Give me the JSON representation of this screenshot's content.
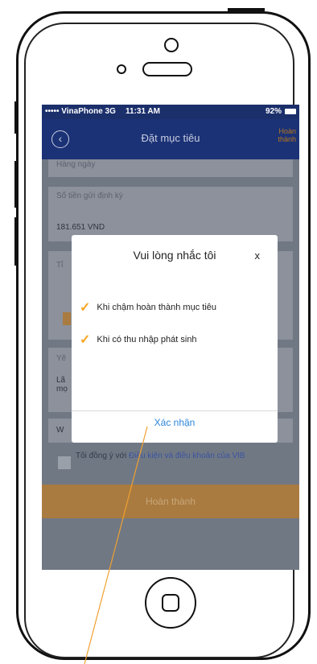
{
  "status_bar": {
    "carrier": "••••• VinaPhone  3G",
    "time": "11:31 AM",
    "battery": "92%"
  },
  "nav": {
    "back_icon": "chevron-left",
    "title": "Đặt mục tiêu",
    "done_line1": "Hoàn",
    "done_line2": "thành"
  },
  "form": {
    "frequency_value": "Hàng ngày",
    "deposit_label": "Số tiền gửi định kỳ",
    "deposit_value": "181.651 VND",
    "field_partial_1": "Tỉ",
    "field_partial_2": "Yê",
    "field_partial_3_line1": "Lã",
    "field_partial_3_line2": "mọ",
    "field_partial_4": "W",
    "agree_text": "Tôi đồng ý với ",
    "agree_link": "Điều kiện và điều khoản của VIB",
    "complete_button": "Hoàn thành"
  },
  "modal": {
    "title": "Vui lòng nhắc tôi",
    "close": "x",
    "options": [
      {
        "label": "Khi chậm hoàn thành mục tiêu",
        "checked": true
      },
      {
        "label": "Khi có thu nhập phát sinh",
        "checked": true
      }
    ],
    "confirm": "Xác nhận"
  },
  "colors": {
    "nav_bg": "#1c3276",
    "accent_orange": "#f5a623",
    "confirm_blue": "#2b86d9",
    "annotation_line": "#f0a030"
  }
}
